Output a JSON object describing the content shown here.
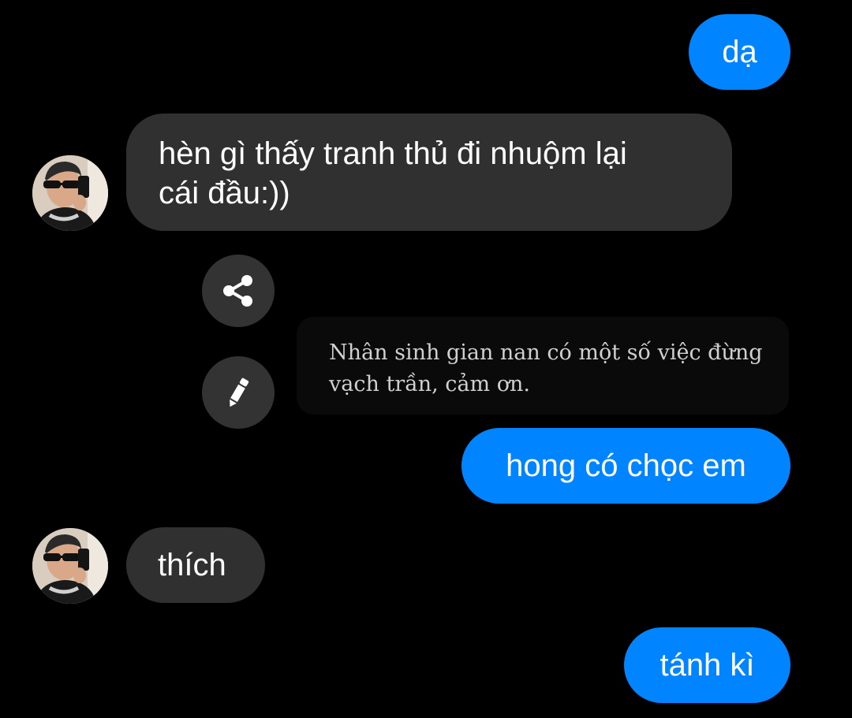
{
  "conversation": {
    "messages": [
      {
        "sender": "me",
        "text": "dạ"
      },
      {
        "sender": "contact",
        "lines": [
          "hèn gì thấy tranh thủ đi nhuộm lại",
          "cái đầu:))"
        ]
      },
      {
        "sender": "me",
        "text": "hong có chọc em"
      },
      {
        "sender": "contact",
        "text": "thích"
      },
      {
        "sender": "me",
        "text": "tánh kì"
      }
    ],
    "quote_card": {
      "lines": [
        "Nhân sinh gian nan có một số việc đừng",
        "vạch trần, cảm ơn."
      ]
    },
    "actions": {
      "share_icon": "share-icon",
      "edit_icon": "pencil-icon"
    }
  },
  "colors": {
    "background": "#000000",
    "outgoing_bubble": "#0084ff",
    "incoming_bubble": "#303030",
    "action_button": "#333333",
    "text": "#ffffff"
  }
}
